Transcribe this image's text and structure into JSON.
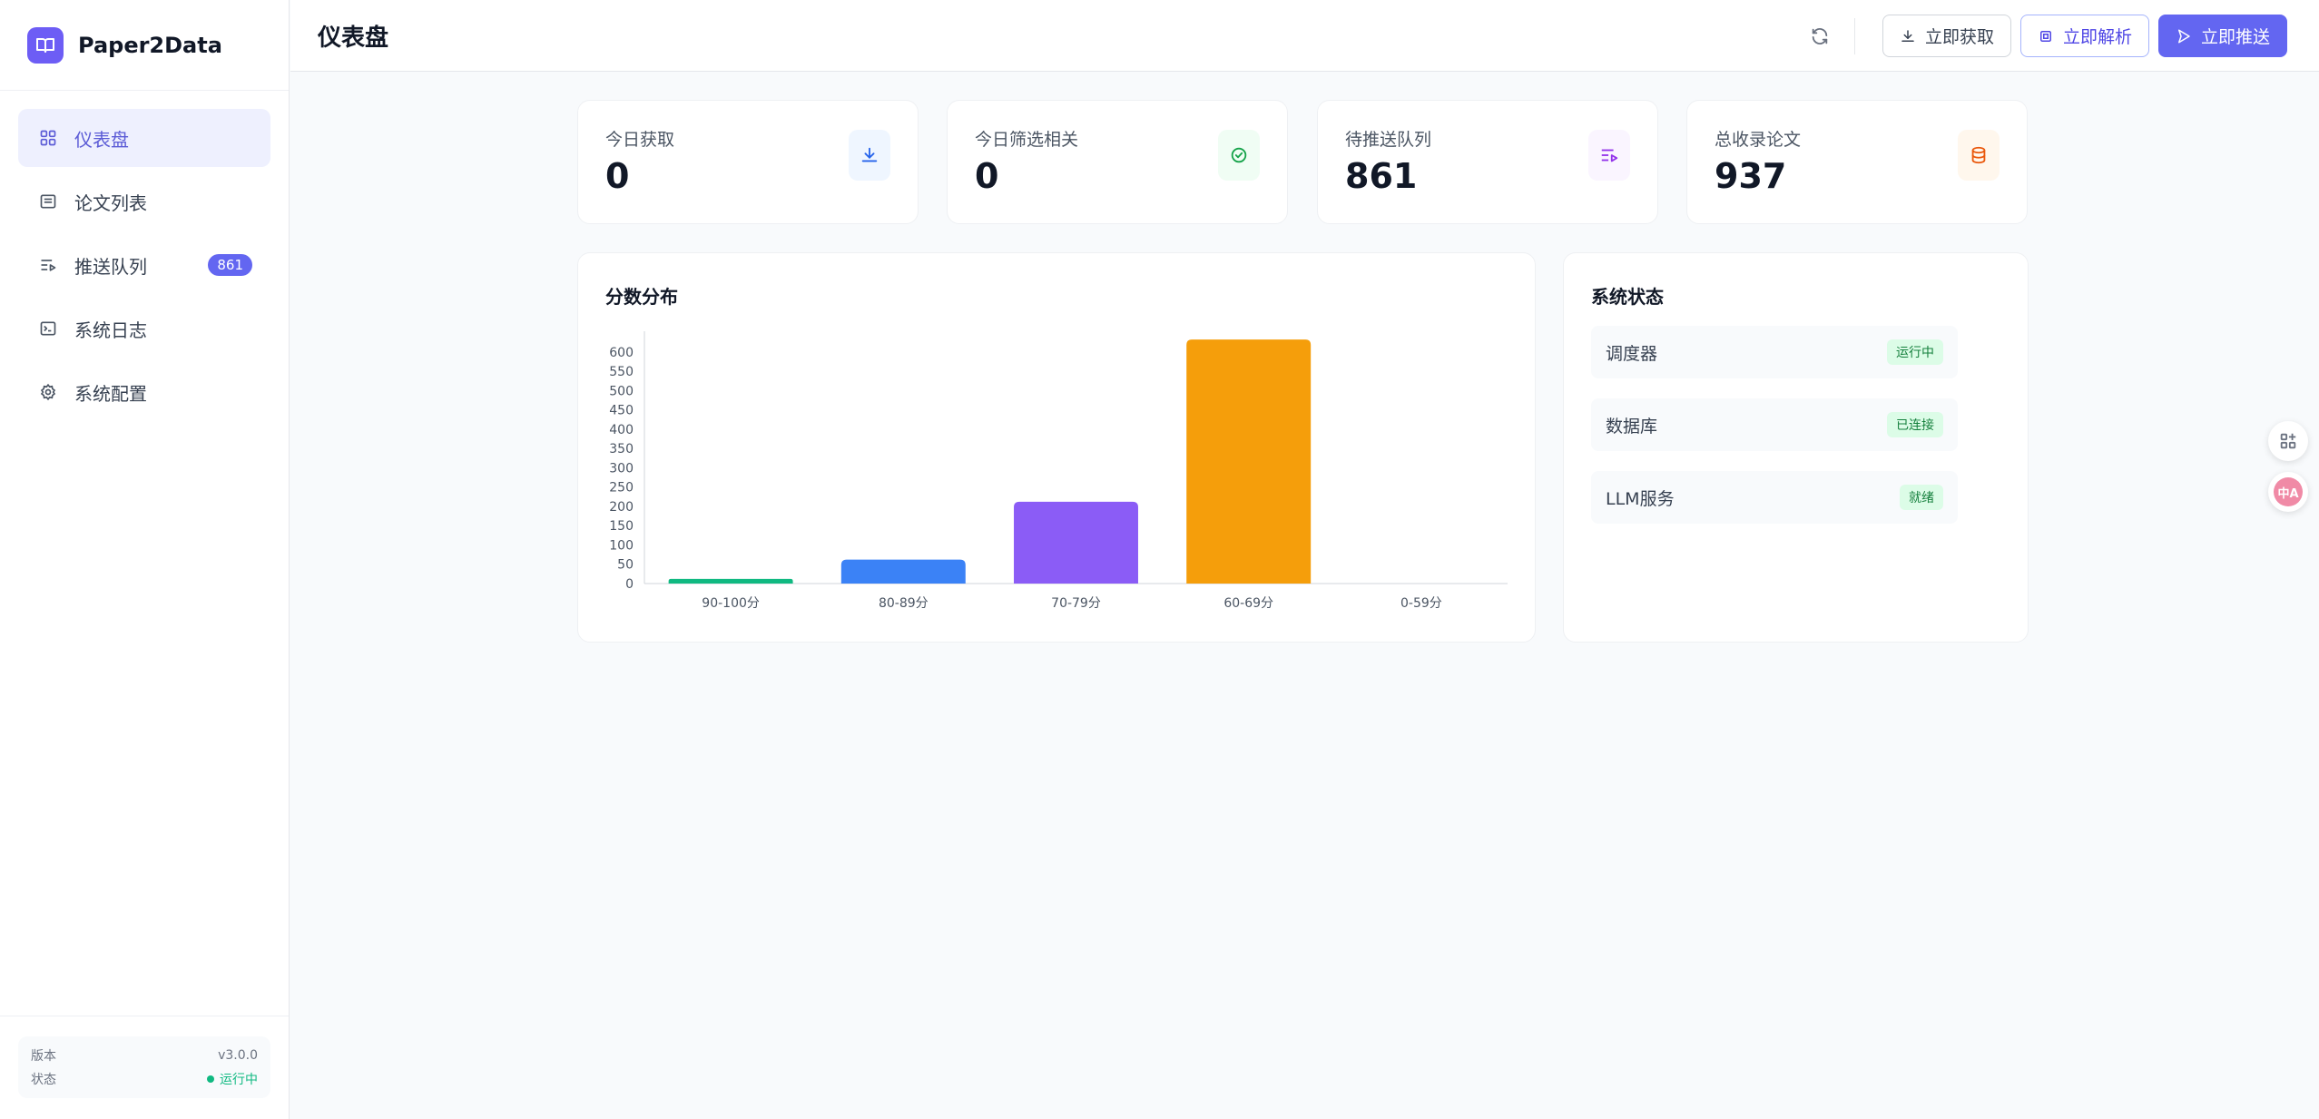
{
  "app": {
    "name": "Paper2Data"
  },
  "sidebar": {
    "items": [
      {
        "label": "仪表盘",
        "icon": "dashboard-grid-icon",
        "active": true
      },
      {
        "label": "论文列表",
        "icon": "list-icon"
      },
      {
        "label": "推送队列",
        "icon": "queue-play-icon",
        "badge": "861"
      },
      {
        "label": "系统日志",
        "icon": "terminal-icon"
      },
      {
        "label": "系统配置",
        "icon": "gear-icon"
      }
    ],
    "footer": {
      "version_label": "版本",
      "version_value": "v3.0.0",
      "status_label": "状态",
      "status_value": "运行中"
    }
  },
  "header": {
    "title": "仪表盘",
    "buttons": {
      "fetch": "立即获取",
      "parse": "立即解析",
      "push": "立即推送"
    }
  },
  "stats": [
    {
      "label": "今日获取",
      "value": "0",
      "icon": "download-icon",
      "color": "#2563eb",
      "bg": "#eff6ff"
    },
    {
      "label": "今日筛选相关",
      "value": "0",
      "icon": "check-circle-icon",
      "color": "#16a34a",
      "bg": "#f0fdf4"
    },
    {
      "label": "待推送队列",
      "value": "861",
      "icon": "queue-play-icon",
      "color": "#9333ea",
      "bg": "#faf5ff"
    },
    {
      "label": "总收录论文",
      "value": "937",
      "icon": "database-icon",
      "color": "#ea580c",
      "bg": "#fff7ed"
    }
  ],
  "chart_panel": {
    "title": "分数分布"
  },
  "chart_data": {
    "type": "bar",
    "categories": [
      "90-100分",
      "80-89分",
      "70-79分",
      "60-69分",
      "0-59分"
    ],
    "values": [
      12,
      62,
      212,
      632,
      0
    ],
    "colors": [
      "#10b981",
      "#3b82f6",
      "#8b5cf6",
      "#f59e0b",
      "#9ca3af"
    ],
    "ylim": [
      0,
      630
    ],
    "yticks": [
      0,
      50,
      100,
      150,
      200,
      250,
      300,
      350,
      400,
      450,
      500,
      550,
      600
    ],
    "grid": false
  },
  "system_status": {
    "title": "系统状态",
    "items": [
      {
        "name": "调度器",
        "status": "运行中"
      },
      {
        "name": "数据库",
        "status": "已连接"
      },
      {
        "name": "LLM服务",
        "status": "就绪"
      }
    ]
  },
  "floating": {
    "translate_label": "中A"
  }
}
